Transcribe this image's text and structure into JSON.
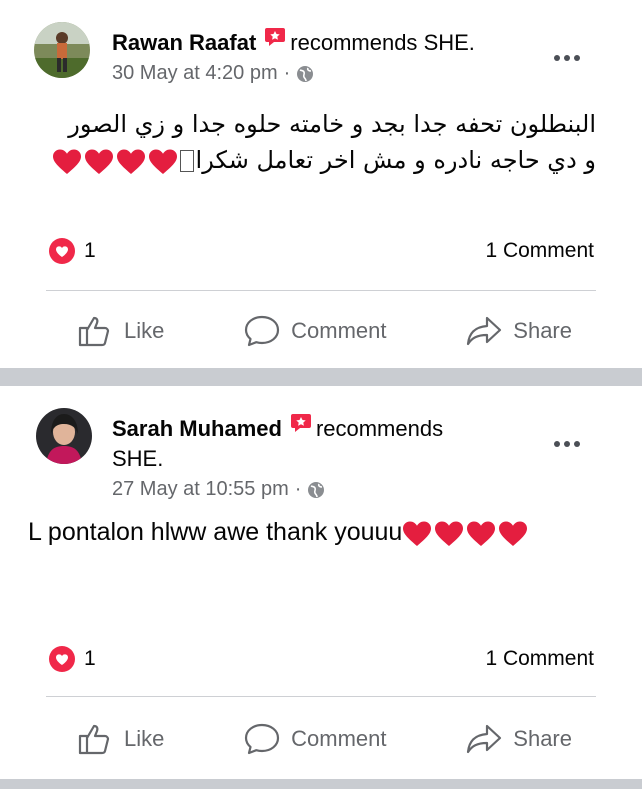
{
  "colors": {
    "text": "#050505",
    "secondary": "#65676b",
    "heart_red": "#e41e3f",
    "badge_red": "#f02849",
    "separator": "#c9ccd1"
  },
  "posts": [
    {
      "author": "Rawan Raafat",
      "verb": "recommends",
      "page": "SHE.",
      "timestamp": "30 May at 4:20 pm",
      "audience_icon": "globe-icon",
      "text_line1": "البنطلون تحفه جدا بجد و خامته حلوه جدا و زي الصور",
      "text_line2": "و دي حاجه نادره و مش اخر تعامل شكرا",
      "heart_count": 4,
      "reaction_count": "1",
      "comments": "1 Comment",
      "actions": {
        "like": "Like",
        "comment": "Comment",
        "share": "Share"
      }
    },
    {
      "author": "Sarah Muhamed",
      "verb": "recommends",
      "page": "SHE.",
      "timestamp": "27 May at 10:55 pm",
      "audience_icon": "globe-icon",
      "text": "L pontalon hlww awe thank youuu",
      "heart_count": 4,
      "reaction_count": "1",
      "comments": "1 Comment",
      "actions": {
        "like": "Like",
        "comment": "Comment",
        "share": "Share"
      }
    }
  ]
}
